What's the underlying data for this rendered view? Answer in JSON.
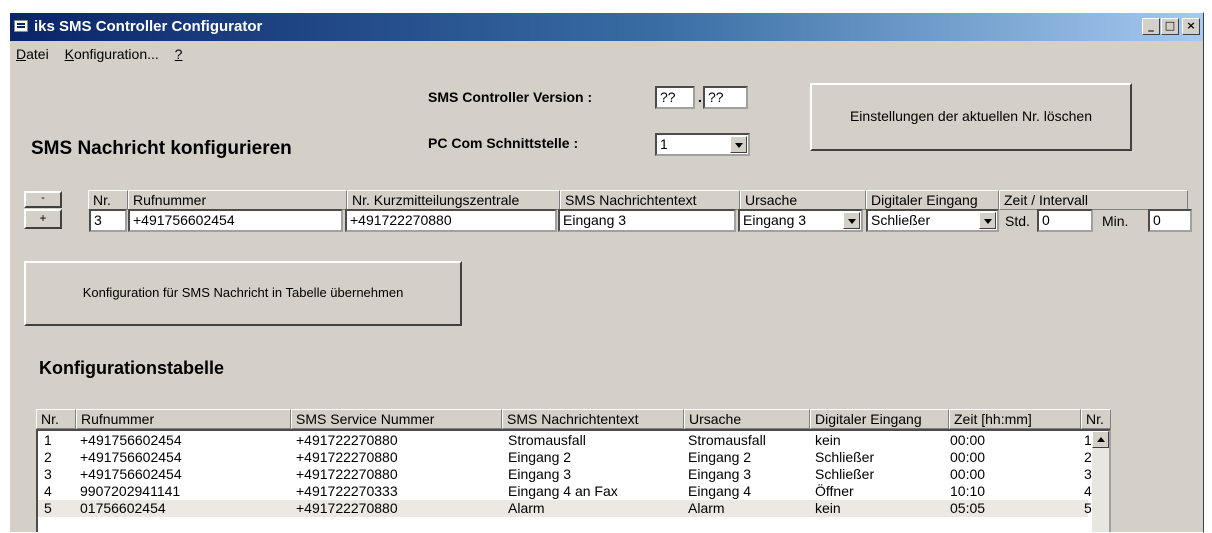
{
  "window": {
    "title": "iks SMS Controller Configurator",
    "controls": {
      "minimize": "_",
      "maximize": "□",
      "close": "×"
    }
  },
  "menu": [
    {
      "label_acc": "D",
      "label_rest": "atei"
    },
    {
      "label_acc": "K",
      "label_rest": "onfiguration..."
    },
    {
      "label_acc": "?",
      "label_rest": ""
    }
  ],
  "header": {
    "version_label": "SMS Controller Version :",
    "version_major": "??",
    "version_sep": ".",
    "version_minor": "??",
    "port_label": "PC Com Schnittstelle :",
    "port_value": "1",
    "delete_button": "Einstellungen der aktuellen Nr. löschen",
    "section_title": "SMS Nachricht konfigurieren"
  },
  "editor": {
    "minus_button": "-",
    "plus_button": "+",
    "columns": [
      "Nr.",
      "Rufnummer",
      "Nr. Kurzmitteilungszentrale",
      "SMS Nachrichtentext",
      "Ursache",
      "Digitaler Eingang",
      "Zeit  / Intervall"
    ],
    "values": {
      "nr": "3",
      "rufnummer": "+491756602454",
      "zentrale": "+491722270880",
      "text": "Eingang 3",
      "ursache": "Eingang 3",
      "eingang": "Schließer",
      "std_label": "Std.",
      "std": "0",
      "min_label": "Min.",
      "min": "0"
    },
    "apply_button": "Konfiguration für SMS Nachricht in Tabelle übernehmen"
  },
  "table": {
    "title": "Konfigurationstabelle",
    "headers": [
      "Nr.",
      "Rufnummer",
      "SMS Service Nummer",
      "SMS Nachrichtentext",
      "Ursache",
      "Digitaler Eingang",
      "Zeit  [hh:mm]",
      "Nr."
    ],
    "rows": [
      {
        "nr": "1",
        "ruf": "+491756602454",
        "svc": "+491722270880",
        "text": "Stromausfall",
        "urs": "Stromausfall",
        "dig": "kein",
        "zeit": "00:00",
        "nr2": "1"
      },
      {
        "nr": "2",
        "ruf": "+491756602454",
        "svc": "+491722270880",
        "text": "Eingang 2",
        "urs": "Eingang 2",
        "dig": "Schließer",
        "zeit": "00:00",
        "nr2": "2"
      },
      {
        "nr": "3",
        "ruf": "+491756602454",
        "svc": "+491722270880",
        "text": "Eingang 3",
        "urs": "Eingang 3",
        "dig": "Schließer",
        "zeit": "00:00",
        "nr2": "3"
      },
      {
        "nr": "4",
        "ruf": "9907202941141",
        "svc": "+491722270333",
        "text": "Eingang 4 an Fax",
        "urs": "Eingang 4",
        "dig": "Öffner",
        "zeit": "10:10",
        "nr2": "4"
      },
      {
        "nr": "5",
        "ruf": "01756602454",
        "svc": "+491722270880",
        "text": "Alarm",
        "urs": "Alarm",
        "dig": "kein",
        "zeit": "05:05",
        "nr2": "5"
      }
    ]
  }
}
